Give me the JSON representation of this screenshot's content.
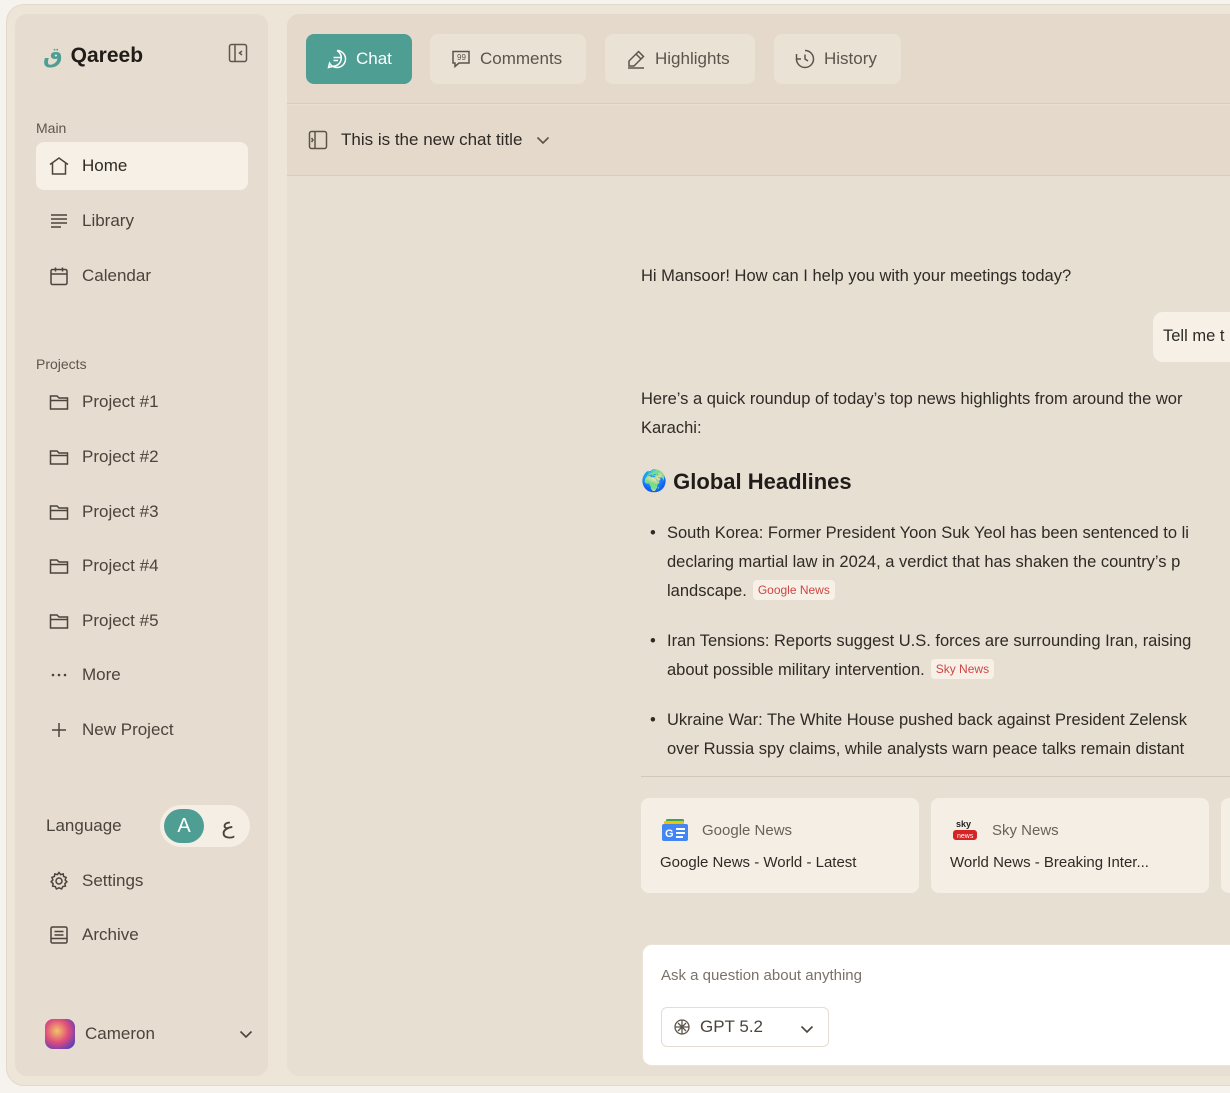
{
  "app": {
    "brand_mark": "ق",
    "brand_name": "Qareeb"
  },
  "sidebar": {
    "main_label": "Main",
    "main_items": [
      {
        "label": "Home",
        "icon": "home-icon",
        "active": true
      },
      {
        "label": "Library",
        "icon": "library-icon"
      },
      {
        "label": "Calendar",
        "icon": "calendar-icon"
      }
    ],
    "projects_label": "Projects",
    "project_items": [
      {
        "label": "Project #1",
        "icon": "folder-icon"
      },
      {
        "label": "Project #2",
        "icon": "folder-icon"
      },
      {
        "label": "Project #3",
        "icon": "folder-icon"
      },
      {
        "label": "Project #4",
        "icon": "folder-icon"
      },
      {
        "label": "Project #5",
        "icon": "folder-icon"
      },
      {
        "label": "More",
        "icon": "ellipsis-icon"
      },
      {
        "label": "New Project",
        "icon": "plus-icon"
      }
    ],
    "language_label": "Language",
    "language_options": [
      "A",
      "ع"
    ],
    "settings_label": "Settings",
    "archive_label": "Archive",
    "user_name": "Cameron"
  },
  "tabs": [
    {
      "label": "Chat",
      "icon": "chat-bubble-icon",
      "active": true
    },
    {
      "label": "Comments",
      "icon": "quote-icon"
    },
    {
      "label": "Highlights",
      "icon": "highlighter-icon"
    },
    {
      "label": "History",
      "icon": "history-icon"
    }
  ],
  "chat": {
    "title": "This is the new chat title",
    "greeting": "Hi Mansoor! How can I help you with your meetings today?",
    "user_message": "Tell me t",
    "intro_line1": "Here’s a quick roundup of today’s top news highlights from around the wor",
    "intro_line2": "Karachi:",
    "section_emoji": "🌍",
    "section_title": "Global Headlines",
    "bullets": [
      {
        "line1": "South Korea: Former President Yoon Suk Yeol has been sentenced to li",
        "line2": "declaring martial law in 2024, a verdict that has shaken the country’s p",
        "line3": "landscape.",
        "cite": "Google News"
      },
      {
        "line1": "Iran Tensions: Reports suggest U.S. forces are surrounding Iran, raising",
        "line2": "about possible military intervention.",
        "cite": "Sky News"
      },
      {
        "line1": "Ukraine War: The White House pushed back against President Zelensk",
        "line2": "over Russia spy claims, while analysts warn peace talks remain distant"
      }
    ],
    "sources": [
      {
        "source": "Google News",
        "title": "Google News - World - Latest",
        "icon": "google-news-logo"
      },
      {
        "source": "Sky News",
        "title": "World News - Breaking Inter...",
        "icon": "sky-news-logo"
      }
    ]
  },
  "composer": {
    "placeholder": "Ask a question about anything",
    "model": "GPT 5.2"
  },
  "colors": {
    "accent": "#4e9e94",
    "citation": "#d04545",
    "background": "#eee5d9"
  }
}
